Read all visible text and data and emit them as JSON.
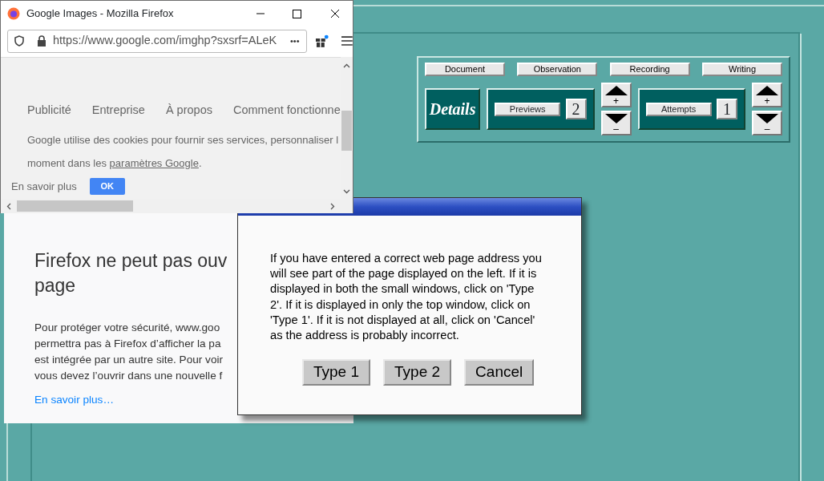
{
  "browser_window": {
    "title": "Google Images - Mozilla Firefox",
    "url": "https://www.google.com/imghp?sxsrf=ALeK",
    "more": "•••",
    "footer_links": [
      "Publicité",
      "Entreprise",
      "À propos",
      "Comment fonctionne"
    ],
    "cookie_line_1": "Google utilise des cookies pour fournir ses services, personnaliser l",
    "cookie_line_2": "moment dans les",
    "cookie_link": "paramètres Google",
    "cookie_end": ".",
    "learn_more": "En savoir plus",
    "ok_button": "OK"
  },
  "error_frame": {
    "heading_lines": [
      "Firefox ne peut pas ouv",
      "page"
    ],
    "body_lines": [
      "Pour protéger votre sécurité, www.goo",
      "permettra pas à Firefox d’afficher la pa",
      "est intégrée par un autre site. Pour voir",
      "vous devez l’ouvrir dans une nouvelle f"
    ],
    "link": "En savoir plus…"
  },
  "control_panel": {
    "tabs": [
      "Document",
      "Observation",
      "Recording",
      "Writing"
    ],
    "title": "Details",
    "counters": [
      {
        "label": "Previews",
        "value": "2",
        "plus": "+",
        "minus": "–"
      },
      {
        "label": "Attempts",
        "value": "1",
        "plus": "+",
        "minus": "–"
      }
    ]
  },
  "dialog": {
    "message": "If you have entered a correct web page address you will see part of the page displayed on the left. If it is displayed in both the small windows, click on 'Type 2'. If it is displayed in only the top window, click on 'Type 1'. If it is not displayed at all, click on 'Cancel' as the address is probably incorrect.",
    "buttons": [
      "Type 1",
      "Type 2",
      "Cancel"
    ]
  }
}
